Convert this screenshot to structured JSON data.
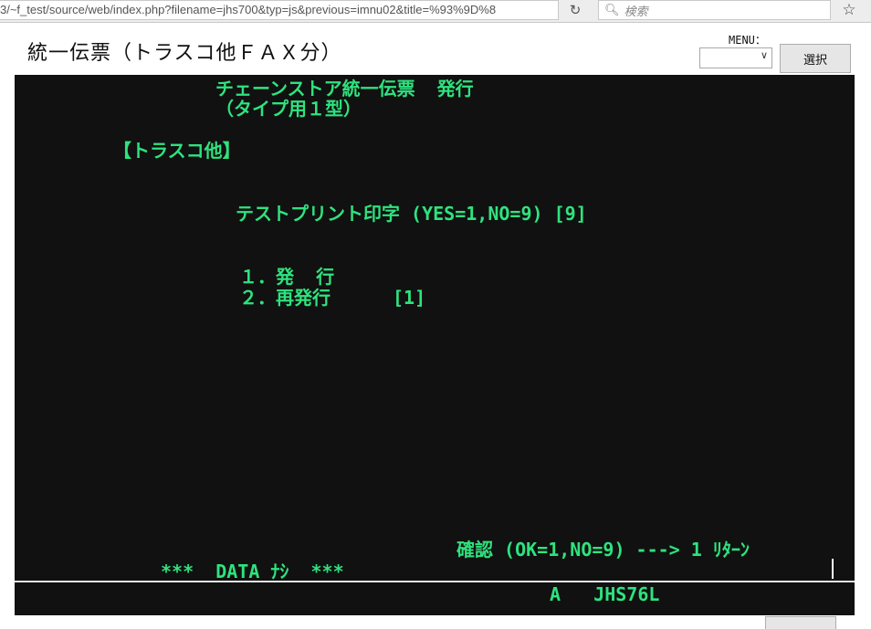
{
  "browser": {
    "url": "3/~f_test/source/web/index.php?filename=jhs700&typ=js&previous=imnu02&title=%93%9D%8",
    "search_placeholder": "検索",
    "reload_icon": "reload-icon",
    "bookmark_icon": "star-icon"
  },
  "header": {
    "title": "統一伝票（トラスコ他ＦＡＸ分）",
    "menu_label": "MENU：",
    "menu_selected": "",
    "select_button": "選択"
  },
  "terminal": {
    "colors": {
      "background": "#111111",
      "text": "#2ee37e"
    },
    "title_line1": "チェーンストア統一伝票  発行",
    "title_line2": "（タイプ用１型）",
    "section": "【トラスコ他】",
    "test_print": "テストプリント印字 (YES=1,NO=9) [9]",
    "option1": "１．発  行",
    "option2": "２．再発行",
    "option_value": "[1]",
    "confirm": "確認 (OK=1,NO=9) ---> 1 ﾘﾀｰﾝ",
    "message": "***  DATA ﾅｼ  ***",
    "status": "A   JHS76L"
  }
}
